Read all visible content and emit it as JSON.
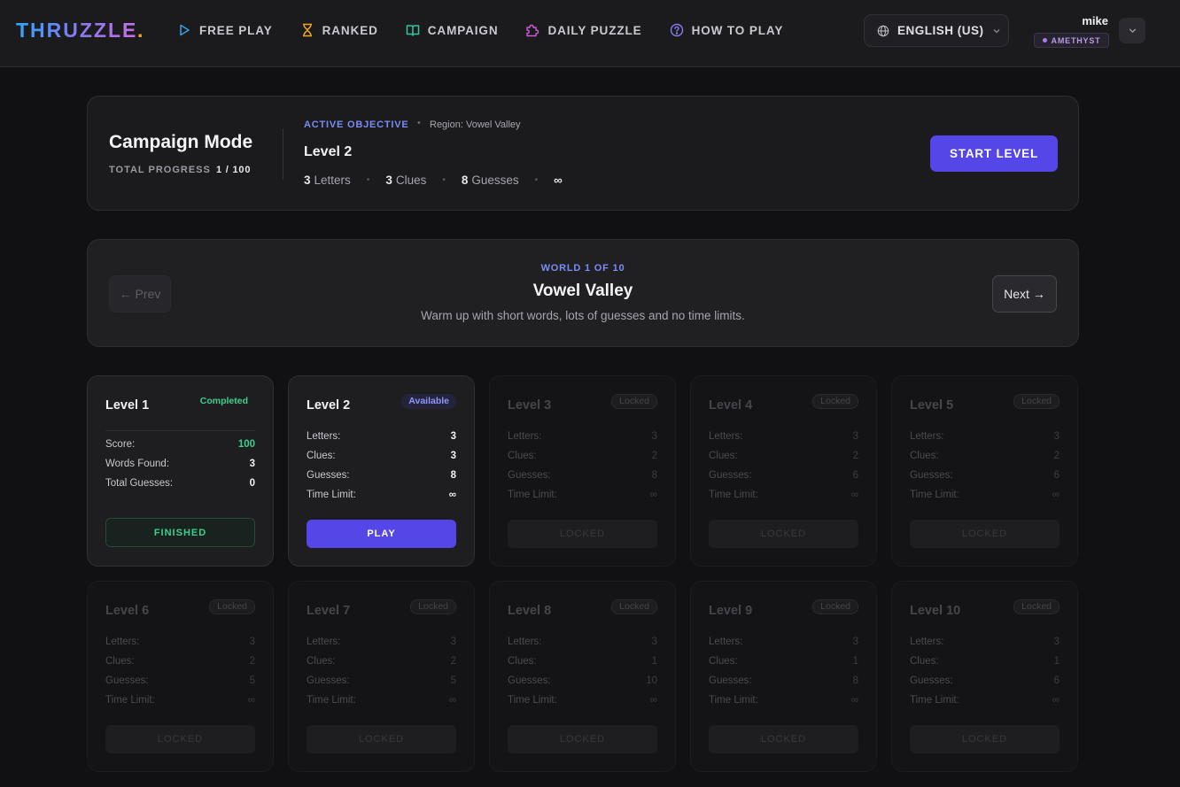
{
  "nav": {
    "logo": "THRUZZLE",
    "logo_dot": ".",
    "items": [
      {
        "label": "FREE PLAY",
        "icon": "play-icon",
        "color": "#3aa0e8"
      },
      {
        "label": "RANKED",
        "icon": "hourglass-icon",
        "color": "#f5a524"
      },
      {
        "label": "CAMPAIGN",
        "icon": "book-icon",
        "color": "#2fc6a0"
      },
      {
        "label": "DAILY PUZZLE",
        "icon": "puzzle-icon",
        "color": "#d05ad8"
      },
      {
        "label": "HOW TO PLAY",
        "icon": "help-icon",
        "color": "#8a7cf0"
      }
    ],
    "language": "ENGLISH (US)",
    "user": {
      "name": "mike",
      "rank": "AMETHYST"
    }
  },
  "campaign": {
    "title": "Campaign Mode",
    "progress_label": "TOTAL PROGRESS",
    "progress_value": "1 / 100",
    "objective_label": "ACTIVE OBJECTIVE",
    "objective_sep": "•",
    "region": "Region: Vowel Valley",
    "level": "Level 2",
    "letters_num": "3",
    "letters_label": "Letters",
    "clues_num": "3",
    "clues_label": "Clues",
    "guesses_num": "8",
    "guesses_label": "Guesses",
    "time": "∞",
    "stat_sep": "•",
    "start_label": "START LEVEL"
  },
  "world": {
    "kicker": "WORLD 1 OF 10",
    "title": "Vowel Valley",
    "description": "Warm up with short words, lots of guesses and no time limits.",
    "prev_label": "← Prev",
    "next_label": "Next →"
  },
  "labels": {
    "score": "Score:",
    "words_found": "Words Found:",
    "total_guesses": "Total Guesses:",
    "letters": "Letters:",
    "clues": "Clues:",
    "guesses": "Guesses:",
    "time_limit": "Time Limit:"
  },
  "levels": [
    {
      "title": "Level 1",
      "badge": "Completed",
      "score": "100",
      "words_found": "3",
      "total_guesses": "0",
      "button": "FINISHED"
    },
    {
      "title": "Level 2",
      "badge": "Available",
      "letters": "3",
      "clues": "3",
      "guesses": "8",
      "time": "∞",
      "button": "PLAY"
    },
    {
      "title": "Level 3",
      "badge": "Locked",
      "letters": "3",
      "clues": "2",
      "guesses": "8",
      "time": "∞",
      "button": "LOCKED"
    },
    {
      "title": "Level 4",
      "badge": "Locked",
      "letters": "3",
      "clues": "2",
      "guesses": "6",
      "time": "∞",
      "button": "LOCKED"
    },
    {
      "title": "Level 5",
      "badge": "Locked",
      "letters": "3",
      "clues": "2",
      "guesses": "6",
      "time": "∞",
      "button": "LOCKED"
    },
    {
      "title": "Level 6",
      "badge": "Locked",
      "letters": "3",
      "clues": "2",
      "guesses": "5",
      "time": "∞",
      "button": "LOCKED"
    },
    {
      "title": "Level 7",
      "badge": "Locked",
      "letters": "3",
      "clues": "2",
      "guesses": "5",
      "time": "∞",
      "button": "LOCKED"
    },
    {
      "title": "Level 8",
      "badge": "Locked",
      "letters": "3",
      "clues": "1",
      "guesses": "10",
      "time": "∞",
      "button": "LOCKED"
    },
    {
      "title": "Level 9",
      "badge": "Locked",
      "letters": "3",
      "clues": "1",
      "guesses": "8",
      "time": "∞",
      "button": "LOCKED"
    },
    {
      "title": "Level 10",
      "badge": "Locked",
      "letters": "3",
      "clues": "1",
      "guesses": "6",
      "time": "∞",
      "button": "LOCKED"
    }
  ]
}
